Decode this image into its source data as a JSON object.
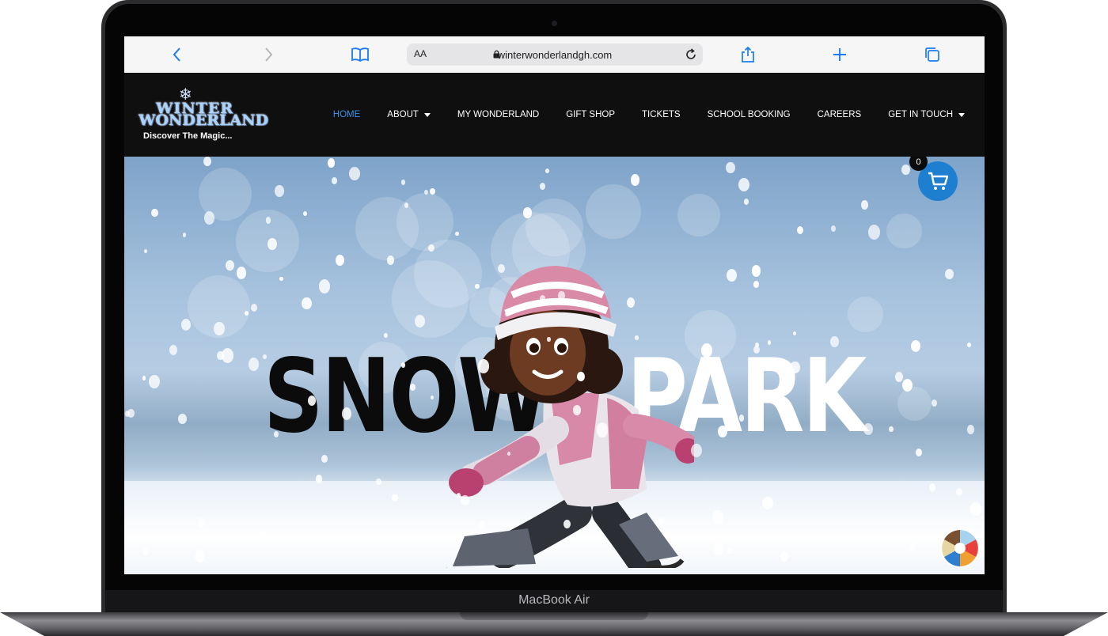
{
  "browser": {
    "url": "winterwonderlandgh.com",
    "text_size_label": "AA"
  },
  "site": {
    "logo_line1": "WINTER",
    "logo_line2": "WONDERLAND",
    "tagline": "Discover The Magic...",
    "nav": [
      {
        "label": "HOME",
        "active": true,
        "dropdown": false
      },
      {
        "label": "ABOUT",
        "active": false,
        "dropdown": true
      },
      {
        "label": "MY WONDERLAND",
        "active": false,
        "dropdown": false
      },
      {
        "label": "GIFT SHOP",
        "active": false,
        "dropdown": false
      },
      {
        "label": "TICKETS",
        "active": false,
        "dropdown": false
      },
      {
        "label": "SCHOOL BOOKING",
        "active": false,
        "dropdown": false
      },
      {
        "label": "CAREERS",
        "active": false,
        "dropdown": false
      },
      {
        "label": "GET IN TOUCH",
        "active": false,
        "dropdown": true
      }
    ],
    "accent_color": "#1e7fd1",
    "active_nav_color": "#3a8fe6"
  },
  "hero": {
    "word1": "SNOW",
    "word2": "PARK"
  },
  "cart": {
    "count": "0"
  },
  "device": {
    "model_label": "MacBook Air"
  }
}
